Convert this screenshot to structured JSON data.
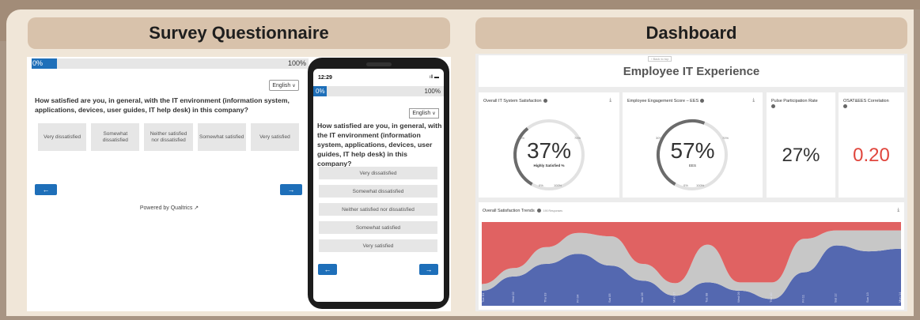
{
  "survey_section": {
    "title": "Survey Questionnaire",
    "desktop": {
      "progress_start": "0%",
      "progress_end": "100%",
      "progress_fraction": 0.09,
      "language": "English",
      "question": "How satisfied are you, in general, with the IT environment (information system, applications, devices, user guides, IT help desk) in this company?",
      "options": [
        "Very dissatisfied",
        "Somewhat dissatisfied",
        "Neither satisfied nor dissatisfied",
        "Somewhat satisfied",
        "Very satisfied"
      ],
      "prev_label": "←",
      "next_label": "→",
      "powered_by": "Powered by Qualtrics ↗"
    },
    "mobile": {
      "time": "12:29",
      "signal": "ıll ▬",
      "progress_start": "0%",
      "progress_end": "100%",
      "progress_fraction": 0.1,
      "language": "English",
      "question": "How satisfied are you, in general, with the IT environment (information system, applications, devices, user guides, IT help desk) in this company?",
      "options": [
        "Very dissatisfied",
        "Somewhat dissatisfied",
        "Neither satisfied nor dissatisfied",
        "Somewhat satisfied",
        "Very satisfied"
      ],
      "prev_label": "←",
      "next_label": "→"
    }
  },
  "dashboard_section": {
    "title": "Dashboard",
    "back_link": "‹ Back to top",
    "dashboard_title": "Employee IT Experience",
    "download_icon": "download-icon",
    "cards": [
      {
        "title": "Overall IT System Satisfaction",
        "value": "37%",
        "value_fraction": 0.37,
        "caption": "Highly Satisfied %",
        "tick_min": "0%",
        "tick_max": "100%",
        "tick_mid_left": "35%",
        "tick_mid_right": "70%"
      },
      {
        "title": "Employee Engagement Score – EES",
        "value": "57%",
        "value_fraction": 0.57,
        "caption": "EES",
        "tick_min": "0%",
        "tick_max": "100%",
        "tick_mid_left": "30%",
        "tick_mid_right": "70%"
      },
      {
        "title": "Pulse Participation Rate",
        "value": "27%"
      },
      {
        "title": "OSAT&EES Correlation",
        "value": "0.20",
        "value_color": "#e0463d"
      }
    ],
    "trend": {
      "title": "Overall Satisfaction Trends",
      "responses": "190 Responses",
      "colors": {
        "red": "#e06262",
        "gray": "#c7c7c7",
        "blue": "#5468b0"
      },
      "x_labels": [
        "Tue 01",
        "Wed 02",
        "Thu 03",
        "Fri 04",
        "Sat 05",
        "Sun 06",
        "Mon 07",
        "Tue 08",
        "Wed 09",
        "Thu 10",
        "Fri 11",
        "Sat 12",
        "Sun 13",
        "Mon 14"
      ]
    }
  },
  "chart_data": {
    "type": "area",
    "title": "Overall Satisfaction Trends",
    "categories": [
      "Tue 01",
      "Wed 02",
      "Thu 03",
      "Fri 04",
      "Sat 05",
      "Sun 06",
      "Mon 07",
      "Tue 08",
      "Wed 09",
      "Thu 10",
      "Fri 11",
      "Sat 12",
      "Sun 13",
      "Mon 14"
    ],
    "stacked_percent": true,
    "series": [
      {
        "color": "#5468b0",
        "values": [
          18,
          35,
          50,
          62,
          48,
          30,
          12,
          28,
          18,
          8,
          40,
          72,
          65,
          68
        ]
      },
      {
        "color": "#c7c7c7",
        "values": [
          8,
          10,
          20,
          25,
          35,
          20,
          15,
          45,
          10,
          20,
          40,
          18,
          25,
          22
        ]
      },
      {
        "color": "#e06262",
        "values": [
          74,
          55,
          30,
          13,
          17,
          50,
          73,
          27,
          72,
          72,
          20,
          10,
          10,
          10
        ]
      }
    ],
    "ylim": [
      0,
      100
    ]
  }
}
